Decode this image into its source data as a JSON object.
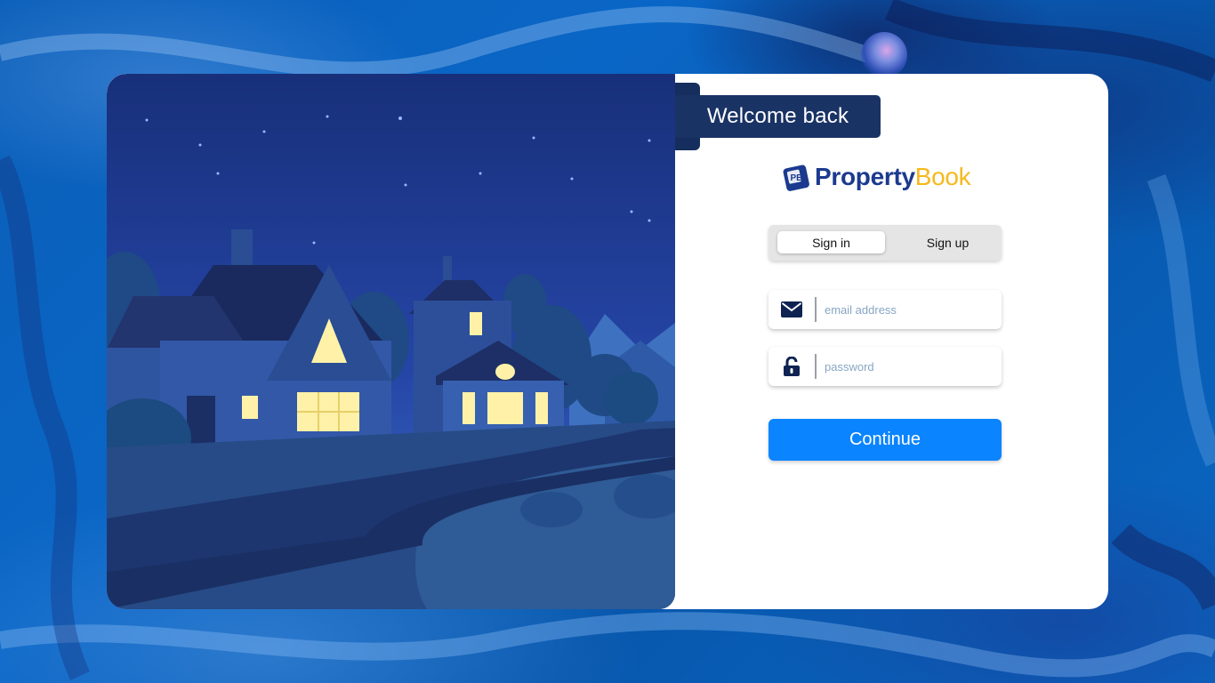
{
  "card": {
    "welcome_text": "Welcome back"
  },
  "logo": {
    "mark_text": "PB",
    "name_part1": "Property",
    "name_part2": "Book",
    "color_primary": "#1b3a8f",
    "color_accent": "#f5b91c"
  },
  "auth_tabs": {
    "selected": "Sign in",
    "items": [
      {
        "label": "Sign in"
      },
      {
        "label": "Sign up"
      }
    ]
  },
  "form": {
    "email": {
      "placeholder": "email address",
      "value": "",
      "icon": "envelope-icon"
    },
    "password": {
      "placeholder": "password",
      "value": "",
      "icon": "unlocked-padlock-icon"
    },
    "continue_label": "Continue"
  },
  "colors": {
    "button": "#0a84ff",
    "banner": "#1a3365"
  },
  "illustration": {
    "subject": "night-suburban-house"
  }
}
